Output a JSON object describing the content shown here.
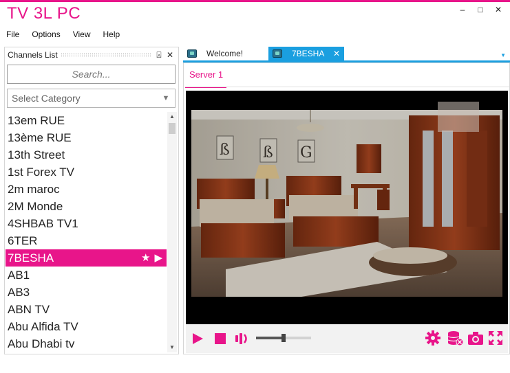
{
  "app": {
    "title": "TV 3L PC"
  },
  "window": {
    "minimize": "–",
    "maximize": "□",
    "close": "✕"
  },
  "menu": [
    "File",
    "Options",
    "View",
    "Help"
  ],
  "channels_panel": {
    "title": "Channels List",
    "pin": "⍓",
    "close": "✕",
    "search_placeholder": "Search...",
    "category_placeholder": "Select Category",
    "items": [
      "13em RUE",
      "13ème RUE",
      "13th Street",
      "1st Forex TV",
      "2m maroc",
      "2M Monde",
      "4SHBAB TV1",
      "6TER",
      "7BESHA",
      "AB1",
      "AB3",
      "ABN TV",
      "Abu Alfida TV",
      "Abu Dhabi tv"
    ],
    "selected_index": 8
  },
  "tabs": [
    {
      "label": "Welcome!",
      "active": false
    },
    {
      "label": "7BESHA",
      "active": true,
      "close": "✕"
    }
  ],
  "server_tab": "Server 1",
  "player": {
    "volume_percent": 50
  },
  "colors": {
    "accent": "#e8158a",
    "tab_blue": "#1a9fe0"
  }
}
